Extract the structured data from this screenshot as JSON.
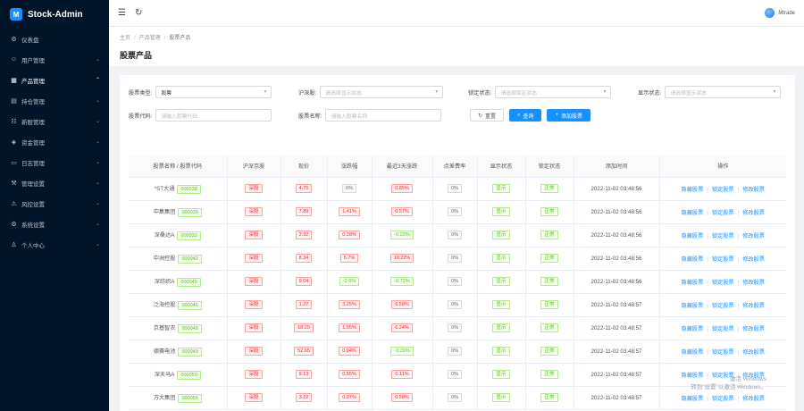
{
  "brand": {
    "title": "Stock-Admin",
    "logo": "M"
  },
  "sidebar": {
    "items": [
      {
        "icon": "⚙",
        "label": "仪表盘",
        "caret": ""
      },
      {
        "icon": "☺",
        "label": "用户管理",
        "caret": "⌄"
      },
      {
        "icon": "▦",
        "label": "产品管理",
        "caret": "⌃",
        "active": true
      },
      {
        "icon": "▤",
        "label": "持仓管理",
        "caret": "⌄"
      },
      {
        "icon": "☷",
        "label": "新股管理",
        "caret": "⌄"
      },
      {
        "icon": "◈",
        "label": "资金管理",
        "caret": "⌄"
      },
      {
        "icon": "▭",
        "label": "日志管理",
        "caret": "⌄"
      },
      {
        "icon": "⚒",
        "label": "管理设置",
        "caret": "⌄"
      },
      {
        "icon": "⚠",
        "label": "风控设置",
        "caret": "⌄"
      },
      {
        "icon": "⚙",
        "label": "系统设置",
        "caret": "⌄"
      },
      {
        "icon": "♙",
        "label": "个人中心",
        "caret": "⌄"
      }
    ]
  },
  "header": {
    "menu_icon": "☰",
    "refresh_icon": "↻",
    "user_name": "Mtrade"
  },
  "breadcrumb": [
    "主页",
    "产品管理",
    "股票产品"
  ],
  "page_title": "股票产品",
  "filters": {
    "stock_type_label": "股票类型:",
    "stock_type_value": "股票",
    "market_label": "沪深股:",
    "market_placeholder": "请选择显示状态",
    "lock_label": "锁定状态:",
    "lock_placeholder": "请选择锁定状态",
    "show_label": "显示状态:",
    "show_placeholder": "请选择显示状态",
    "code_label": "股票代码:",
    "code_placeholder": "请输入股票代码",
    "name_label": "股票名称:",
    "name_placeholder": "请输入股票名称",
    "reset_label": "重置",
    "query_label": "查询",
    "add_label": "添加股票"
  },
  "table": {
    "headers": [
      "股票名称 / 股票代码",
      "沪深京股",
      "现价",
      "涨跌幅",
      "最近3天涨跌",
      "点差费率",
      "显示状态",
      "锁定状态",
      "添加时间",
      "操作"
    ],
    "actions": [
      "隐藏股票",
      "锁定股票",
      "修改股票"
    ],
    "rows": [
      {
        "name": "*ST大通",
        "code": "000038",
        "market": "深股",
        "price": "4.75",
        "change": "0%",
        "change3": "0.85%",
        "spread": "0%",
        "show": "显示",
        "lock": "正常",
        "time": "2022-11-02 03:48:56"
      },
      {
        "name": "中集集团",
        "code": "000039",
        "market": "深股",
        "price": "7.89",
        "change": "1.41%",
        "change3": "0.57%",
        "spread": "0%",
        "show": "显示",
        "lock": "正常",
        "time": "2022-11-02 03:48:56"
      },
      {
        "name": "深桑达A",
        "code": "000032",
        "market": "深股",
        "price": "3.92",
        "change": "0.28%",
        "change3": "-0.23%",
        "spread": "0%",
        "show": "显示",
        "lock": "正常",
        "time": "2022-11-02 03:48:56"
      },
      {
        "name": "中洲控股",
        "code": "000042",
        "market": "深股",
        "price": "8.34",
        "change": "5.7%",
        "change3": "10.22%",
        "spread": "0%",
        "show": "显示",
        "lock": "正常",
        "time": "2022-11-02 03:48:56"
      },
      {
        "name": "深纺织A",
        "code": "000045",
        "market": "深股",
        "price": "9.04",
        "change": "-2.6%",
        "change3": "-0.72%",
        "spread": "0%",
        "show": "显示",
        "lock": "正常",
        "time": "2022-11-02 03:48:56"
      },
      {
        "name": "泛海控股",
        "code": "000046",
        "market": "深股",
        "price": "1.27",
        "change": "3.25%",
        "change3": "6.58%",
        "spread": "0%",
        "show": "显示",
        "lock": "正常",
        "time": "2022-11-02 03:48:57"
      },
      {
        "name": "京基智农",
        "code": "000048",
        "market": "深股",
        "price": "18.29",
        "change": "1.95%",
        "change3": "6.24%",
        "spread": "0%",
        "show": "显示",
        "lock": "正常",
        "time": "2022-11-02 03:48:57"
      },
      {
        "name": "德赛电池",
        "code": "000049",
        "market": "深股",
        "price": "52.65",
        "change": "0.94%",
        "change3": "-3.39%",
        "spread": "0%",
        "show": "显示",
        "lock": "正常",
        "time": "2022-11-02 03:48:57"
      },
      {
        "name": "深天马A",
        "code": "000050",
        "market": "深股",
        "price": "9.13",
        "change": "0.55%",
        "change3": "0.11%",
        "spread": "0%",
        "show": "显示",
        "lock": "正常",
        "time": "2022-11-02 03:48:57"
      },
      {
        "name": "方大集团",
        "code": "000055",
        "market": "深股",
        "price": "3.22",
        "change": "0.97%",
        "change3": "0.58%",
        "spread": "0%",
        "show": "显示",
        "lock": "正常",
        "time": "2022-11-02 03:48:57"
      }
    ]
  },
  "watermark": {
    "line1": "激活 Windows",
    "line2": "转到\"设置\"以激活 Windows。"
  }
}
